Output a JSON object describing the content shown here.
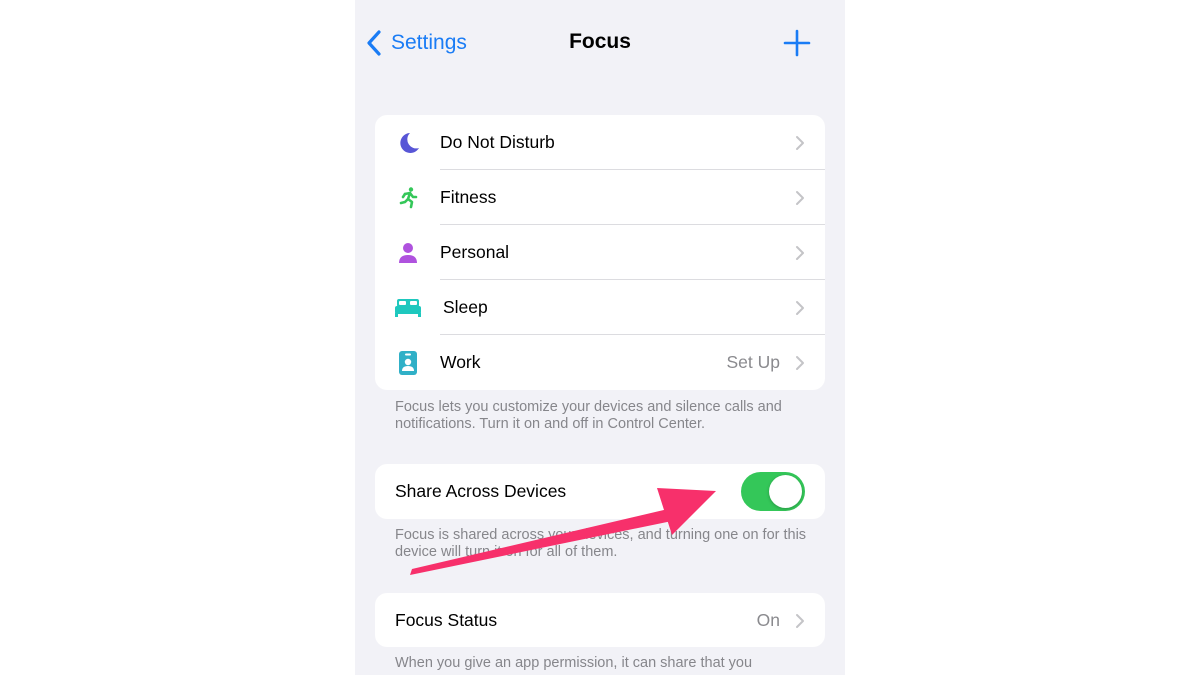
{
  "navbar": {
    "back_label": "Settings",
    "title": "Focus",
    "add_icon": "plus-icon"
  },
  "focus_modes": [
    {
      "label": "Do Not Disturb",
      "icon": "moon-icon",
      "color": "#5856d6",
      "value": ""
    },
    {
      "label": "Fitness",
      "icon": "running-figure-icon",
      "color": "#34c759",
      "value": ""
    },
    {
      "label": "Personal",
      "icon": "person-icon",
      "color": "#af52de",
      "value": ""
    },
    {
      "label": "Sleep",
      "icon": "bed-icon",
      "color": "#1ec8be",
      "value": ""
    },
    {
      "label": "Work",
      "icon": "id-badge-icon",
      "color": "#30b0c7",
      "value": "Set Up"
    }
  ],
  "focus_footnote": "Focus lets you customize your devices and silence calls and notifications. Turn it on and off in Control Center.",
  "share": {
    "label": "Share Across Devices",
    "toggle_on": true,
    "footnote": "Focus is shared across your devices, and turning one on for this device will turn it on for all of them."
  },
  "focus_status": {
    "label": "Focus Status",
    "value": "On",
    "footnote": "When you give an app permission, it can share that you"
  },
  "annotation": {
    "type": "arrow",
    "color": "#f7306b",
    "points_to": "share-across-devices-toggle"
  },
  "colors": {
    "accent": "#1a7cf5",
    "toggle_on": "#34c759",
    "background": "#f2f2f7"
  }
}
